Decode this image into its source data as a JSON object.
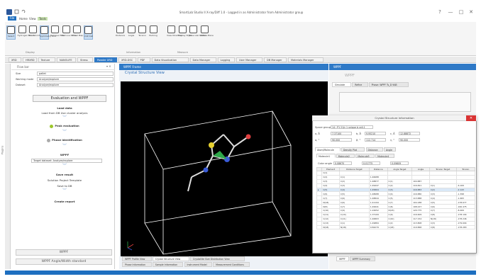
{
  "window": {
    "title": "SmartLab Studio II X-ray/Diff 1.0 - Logged in as Administrator from Administrator group",
    "controls": [
      "?",
      "—",
      "□",
      "✕"
    ]
  },
  "ribbon_tabs": [
    "File",
    "Home",
    "View",
    "Tools"
  ],
  "ribbon_buttons": [
    {
      "label": "Select",
      "icon": "cursor-icon",
      "selected": true
    },
    {
      "label": "Hydrogen Bonds",
      "icon": "hbond-icon"
    },
    {
      "label": "Short Contacts",
      "icon": "contacts-icon"
    },
    {
      "label": "Symmetry Unit",
      "icon": "symmetry-icon",
      "selected": true
    },
    {
      "label": "Remove Hide",
      "icon": "hide-icon"
    },
    {
      "label": "Remove Packs",
      "icon": "packs-icon"
    },
    {
      "label": "Fixed Map",
      "icon": "map-icon"
    },
    {
      "label": "Unit Cell",
      "icon": "cell-icon",
      "selected": true
    },
    {
      "label": "Distance",
      "icon": "distance-icon"
    },
    {
      "label": "Angle",
      "icon": "angle-icon"
    },
    {
      "label": "Torsion",
      "icon": "torsion-icon"
    },
    {
      "label": "Packing",
      "icon": "packing-icon"
    },
    {
      "label": "View Direction",
      "icon": "direction-icon"
    },
    {
      "label": "Display Style",
      "icon": "style-icon"
    },
    {
      "label": "Molecular Model",
      "icon": "model-icon"
    },
    {
      "label": "Lattice Plane",
      "icon": "plane-icon"
    }
  ],
  "ribbon_groups": [
    "Display",
    "Information",
    "Measure"
  ],
  "main_tabs": [
    "XRD",
    "HRXRD",
    "Texture",
    "NANOLIFE",
    "Stress",
    "Powder XRD",
    "XRD-DSC",
    "PDF",
    "Data Visualization",
    "Data Manager",
    "Logging",
    "User Manager",
    "DB Manager",
    "Materials Manager"
  ],
  "active_main_tab": "Powder XRD",
  "sidebar": {
    "label": "Plugins"
  },
  "flow": {
    "header": "Flow bar",
    "fields": [
      {
        "label": "Size",
        "value": "pallet"
      },
      {
        "label": "Working mode",
        "value": "Analyze/explore"
      },
      {
        "label": "Dataset",
        "value": "Analyze/explore"
      }
    ],
    "eval_button": "Evaluation and WPPF",
    "steps": [
      {
        "text": "Load data"
      },
      {
        "text": "Load from DB  Use cluster analysis",
        "checkbox": true
      },
      {
        "text": "Peak evaluation",
        "status": "done"
      },
      {
        "text": "Phase identification",
        "status": "pending"
      },
      {
        "text": "WPPF"
      },
      {
        "text": "Target dataset: Analyze/explore",
        "select": true
      },
      {
        "text": "Save result"
      },
      {
        "text": "Solution  Project  Template",
        "radio": true
      },
      {
        "text": "Save to DB",
        "checkbox": true
      },
      {
        "text": "Create report"
      }
    ],
    "bottom_buttons": [
      "WPPF",
      "WPPF Angle/Width standard"
    ]
  },
  "viewer": {
    "header": "WPPF Frame",
    "title": "Crystal Structure View",
    "axis_indicator": "a b c",
    "bottom_tabs": [
      "WPPF Profile View",
      "Crystal Structure View",
      "Crystallite Size Distribution View"
    ],
    "active_bottom_tab": "Crystal Structure View",
    "info_tabs": [
      "Phase Information",
      "Sample Information",
      "Instrument Model",
      "Measurement Conditions"
    ]
  },
  "right": {
    "header": "WPPF",
    "title": "WPPF",
    "tabs": [
      "Simulate",
      "Refine",
      "Phase: WPPF Ts_D 9AB"
    ],
    "bottom_tabs": [
      "WPPF",
      "WPPF Summary"
    ]
  },
  "dialog": {
    "title": "Crystal Structure Information",
    "fields": {
      "space_group": {
        "label": "Space group",
        "value": "14 : P1 21/c 1 unique b cell-1"
      },
      "a": {
        "label": "a, Å",
        "value": "7.37100"
      },
      "b": {
        "label": "b, Å",
        "value": "9.95210"
      },
      "c": {
        "label": "c, Å",
        "value": "12.88872"
      },
      "alpha": {
        "label": "α, °",
        "value": "90.000"
      },
      "beta": {
        "label": "β, °",
        "value": "112.714"
      },
      "gamma": {
        "label": "γ, °",
        "value": "90.000"
      }
    },
    "tabs": [
      "Atom/Molecule",
      "Density Plot",
      "Distance",
      "Angle"
    ],
    "subtabs": [
      "Molecule1",
      "Molecule2",
      "Molecule3",
      "Molecule4"
    ],
    "color_controls": [
      {
        "label": "Color angle",
        "value": "0.08670"
      },
      {
        "label": "",
        "value": "0.01775"
      },
      {
        "label": "",
        "value": "0.09609"
      }
    ],
    "columns": [
      "Element",
      "Distance Target",
      "Distance",
      "Angle Target",
      "Angle",
      "Torsion Target",
      "Torsion"
    ],
    "rows": [
      [
        "C(1)",
        "",
        "",
        "",
        "",
        "",
        ""
      ],
      [
        "C(2)",
        "C(1)",
        "1.46688",
        "",
        "",
        "",
        ""
      ],
      [
        "C(3)",
        "C(2)",
        "1.48877",
        "C(1)",
        "104.887",
        "",
        ""
      ],
      [
        "C(4)",
        "C(3)",
        "1.49447",
        "C(2)",
        "116.821",
        "C(1)",
        "-6.169"
      ],
      [
        "C(5)",
        "C(4)",
        "1.45804",
        "C(3)",
        "116.883",
        "C(2)",
        "-2.143"
      ],
      [
        "C(6)",
        "C(5)",
        "1.48688",
        "C(4)",
        "116.880",
        "C(3)",
        "-1.398"
      ],
      [
        "C(7)",
        "C(6)",
        "1.48844",
        "C(5)",
        "113.888",
        "C(4)",
        "-1.683"
      ],
      [
        "N(18)",
        "C(6)",
        "1.41194",
        "C(7)",
        "104.188",
        "C(5)",
        "-178.677"
      ],
      [
        "N(8)",
        "C(7)",
        "1.49941",
        "C(8)",
        "108.227",
        "C(6)",
        "-160.475"
      ],
      [
        "C(10)",
        "C(9)",
        "1.22652",
        "N(18)",
        "120.775",
        "C(7)",
        "-8.469"
      ],
      [
        "C(11)",
        "C(10)",
        "1.37109",
        "C(9)",
        "116.609",
        "C(8)",
        "-178.194"
      ],
      [
        "C(12)",
        "C(11)",
        "1.46803",
        "C(10)",
        "117.154",
        "N(18)",
        "-178.246"
      ],
      [
        "C(13)",
        "C(1)",
        "1.49884",
        "C(2)",
        "113.808",
        "C(3)",
        "-179.694"
      ],
      [
        "N(18)",
        "N(18)",
        "0.84279",
        "C(18)",
        "119.868",
        "C(8)",
        "-178.283"
      ]
    ],
    "highlight_row": 4
  },
  "chart_colors": {
    "accent": "#2e79c7",
    "status_done": "#9cc62b"
  }
}
